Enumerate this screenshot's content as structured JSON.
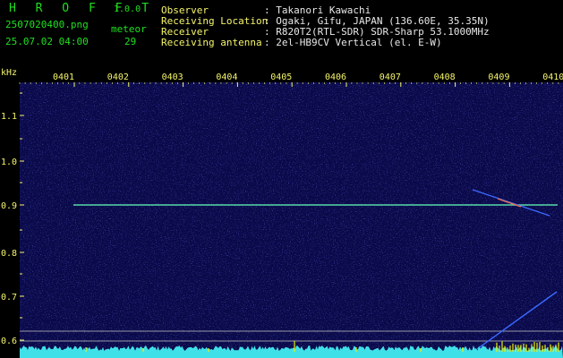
{
  "header": {
    "logo": "H R O F F T",
    "version": "1.0.0",
    "filename": "2507020400.png",
    "datetime": "25.07.02 04:00",
    "meteor_label": "meteor",
    "meteor_count": "29",
    "info_rows": [
      {
        "label": "Observer",
        "value": ": Takanori Kawachi"
      },
      {
        "label": "Receiving Location",
        "value": ": Ogaki, Gifu, JAPAN (136.60E, 35.35N)"
      },
      {
        "label": "Receiver",
        "value": ": R820T2(RTL-SDR) SDR-Sharp 53.1000MHz"
      },
      {
        "label": "Receiving antenna",
        "value": ": 2el-HB9CV Vertical (el. E-W)"
      }
    ]
  },
  "spectrogram": {
    "freq_unit": "kHz",
    "freq_ticks": [
      "1.1",
      "1.0",
      "0.9",
      "0.8",
      "0.7",
      "0.6"
    ],
    "time_ticks": [
      "0401",
      "0402",
      "0403",
      "0404",
      "0405",
      "0406",
      "0407",
      "0408",
      "0409",
      "0410"
    ],
    "colors": {
      "background": "#0a0a4a",
      "carrier": "#2fd0c0",
      "trace": "#3a6aff",
      "floor": "#40e0e8",
      "spikes": "#f0f000",
      "guide_line": "#c8c8c8"
    }
  }
}
